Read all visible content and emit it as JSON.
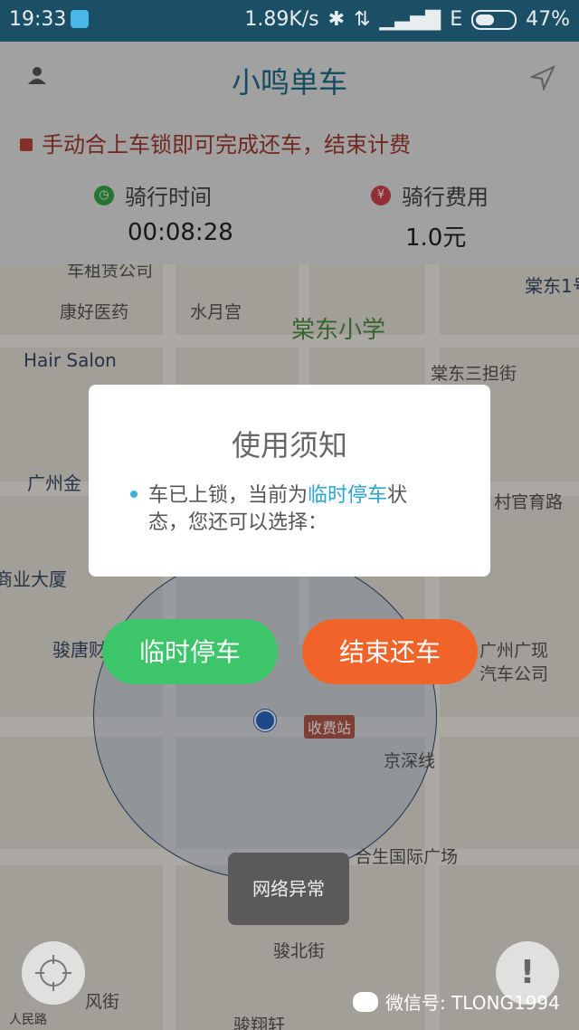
{
  "status_bar": {
    "time": "19:33",
    "network_speed": "1.89K/s",
    "network_type": "E",
    "battery_percent": "47%",
    "battery_level": 0.47
  },
  "app": {
    "title": "小鸣单车"
  },
  "notice": {
    "text": "手动合上车锁即可完成还车，结束计费"
  },
  "stats": {
    "ride_time": {
      "label": "骑行时间",
      "value": "00:08:28"
    },
    "ride_cost": {
      "label": "骑行费用",
      "value": "1.0元"
    }
  },
  "map": {
    "labels": [
      "车租赁公司",
      "康好医药",
      "水月宫",
      "棠东小学",
      "棠东1号",
      "Hair Salon",
      "棠东三担街",
      "广州金",
      "村官育路",
      "商业大厦",
      "骏唐财",
      "广州广现",
      "汽车公司",
      "收费站",
      "京深线",
      "合生国际广场",
      "骏北街",
      "风街",
      "骏翔轩"
    ]
  },
  "dialog": {
    "title": "使用须知",
    "text_before": "车已上锁，当前为",
    "text_highlight": "临时停车",
    "text_after": "状态，您还可以选择："
  },
  "buttons": {
    "temporary_parking": "临时停车",
    "end_return": "结束还车"
  },
  "toast": "网络异常",
  "baidu": "人民路",
  "watermark": "微信号: TLONG1994",
  "colors": {
    "accent": "#1e6e8a",
    "green": "#3cc569",
    "orange": "#f0642a",
    "highlight": "#2aa4d4"
  }
}
